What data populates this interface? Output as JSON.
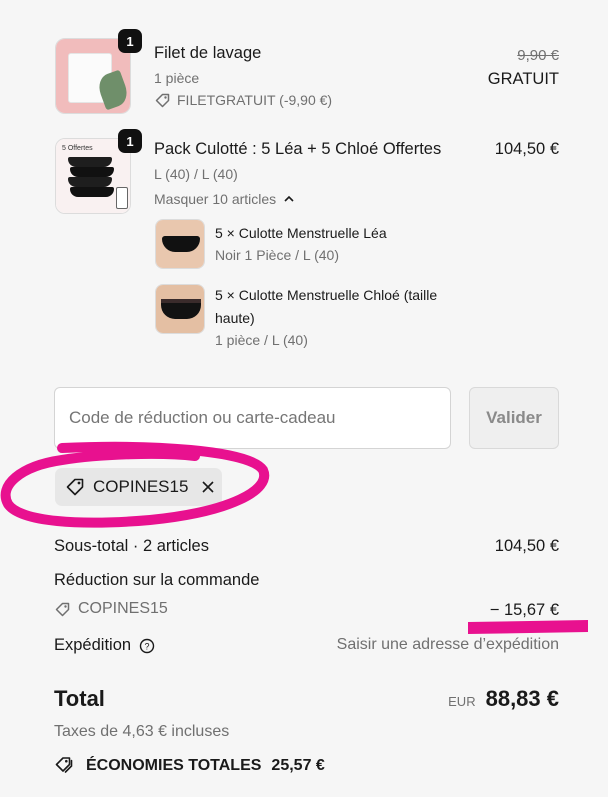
{
  "items": [
    {
      "qty": "1",
      "name": "Filet de lavage",
      "variant": "1 pièce",
      "discount_label": "FILETGRATUIT (-9,90 €)",
      "old_price": "9,90 €",
      "price": "GRATUIT"
    },
    {
      "qty": "1",
      "name": "Pack Culotté : 5 Léa + 5 Chloé Offertes",
      "variant": "L (40) / L (40)",
      "toggle_label": "Masquer 10 articles",
      "price": "104,50 €",
      "thumb_caption": "5 Offertes",
      "sub_items": [
        {
          "title": "5 × Culotte Menstruelle Léa",
          "detail": "Noir 1 Pièce / L (40)"
        },
        {
          "title_line1": "5 × Culotte Menstruelle Chloé (taille",
          "title_line2": "haute)",
          "detail": "1 pièce / L (40)"
        }
      ]
    }
  ],
  "discount": {
    "placeholder": "Code de réduction ou carte-cadeau",
    "apply_label": "Valider",
    "applied_code": "COPINES15"
  },
  "summary": {
    "subtotal_label": "Sous-total · 2 articles",
    "subtotal_value": "104,50 €",
    "order_discount_label": "Réduction sur la commande",
    "order_discount_code": "COPINES15",
    "order_discount_value": "− 15,67 €",
    "shipping_label": "Expédition",
    "shipping_value": "Saisir une adresse d’expédition",
    "total_label": "Total",
    "currency": "EUR",
    "total_value": "88,83 €",
    "taxes": "Taxes de 4,63 € incluses",
    "savings_label": "ÉCONOMIES TOTALES",
    "savings_value": "25,57 €"
  },
  "colors": {
    "annotation": "#e8118f",
    "muted": "#707070",
    "background": "#f6f6f6"
  }
}
